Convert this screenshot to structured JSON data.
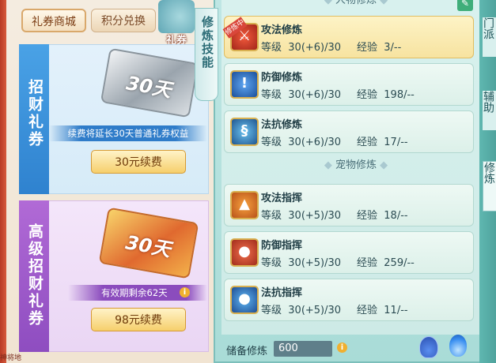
{
  "shop": {
    "tabs": [
      "礼券商城",
      "积分兑换"
    ],
    "ribbon_label": "礼券",
    "corner_label": "神将地",
    "card1": {
      "title": "招财礼券",
      "ticket_label": "30天",
      "desc": "续费将延长30天普通礼券权益",
      "button": "30元续费"
    },
    "card2": {
      "title": "高级招财礼券",
      "ticket_label": "30天",
      "desc": "有效期剩余62天",
      "button": "98元续费"
    }
  },
  "cultivation": {
    "side_tab": "修炼技能",
    "character_header": "人物修炼",
    "pet_header": "宠物修炼",
    "training_badge": "修炼中",
    "character_skills": [
      {
        "name": "攻法修炼",
        "level_label": "等级",
        "level": "30(+6)/30",
        "exp_label": "经验",
        "exp": "3/--",
        "icon": "sword-icon"
      },
      {
        "name": "防御修炼",
        "level_label": "等级",
        "level": "30(+6)/30",
        "exp_label": "经验",
        "exp": "198/--",
        "icon": "shield-icon"
      },
      {
        "name": "法抗修炼",
        "level_label": "等级",
        "level": "30(+6)/30",
        "exp_label": "经验",
        "exp": "17/--",
        "icon": "magic-icon"
      }
    ],
    "pet_skills": [
      {
        "name": "攻法指挥",
        "level_label": "等级",
        "level": "30(+5)/30",
        "exp_label": "经验",
        "exp": "18/--",
        "icon": "pet-attack-icon"
      },
      {
        "name": "防御指挥",
        "level_label": "等级",
        "level": "30(+5)/30",
        "exp_label": "经验",
        "exp": "259/--",
        "icon": "pet-defense-icon"
      },
      {
        "name": "法抗指挥",
        "level_label": "等级",
        "level": "30(+5)/30",
        "exp_label": "经验",
        "exp": "11/--",
        "icon": "pet-magic-icon"
      }
    ],
    "reserve_label": "储备修炼",
    "reserve_value": "600"
  },
  "edge_tabs": [
    "门派",
    "辅助",
    "修炼"
  ]
}
